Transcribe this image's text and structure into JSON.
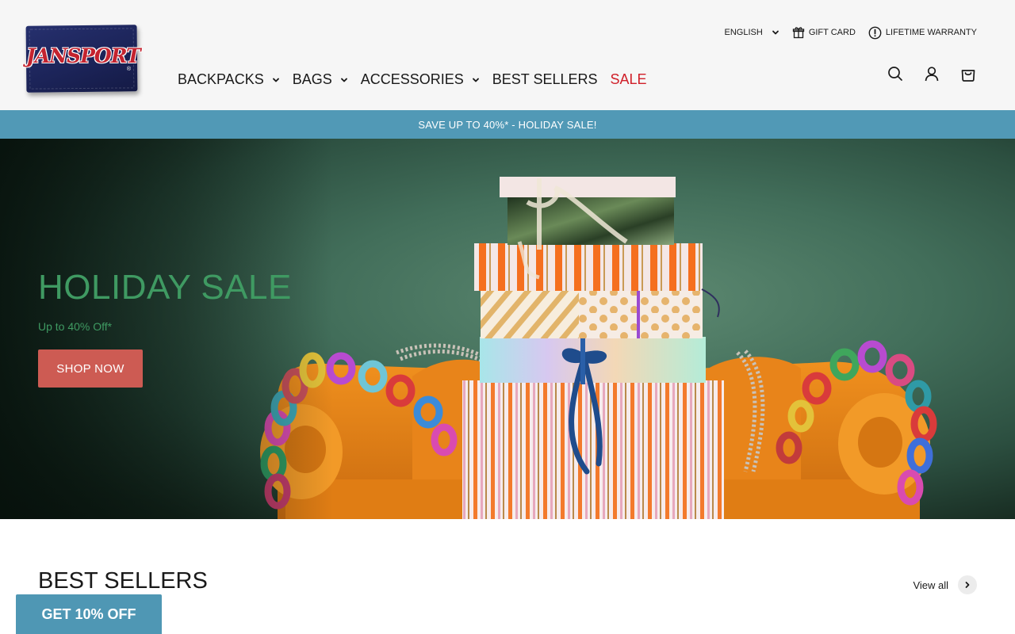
{
  "brand": {
    "logo_text": "JANSPORT",
    "logo_mark": "®",
    "patch_color": "#1c2459",
    "text_color": "#c4232f"
  },
  "topbar": {
    "language": "ENGLISH",
    "gift_card": "GIFT CARD",
    "warranty": "LIFETIME WARRANTY"
  },
  "nav": {
    "items": [
      {
        "label": "BACKPACKS",
        "has_dropdown": true
      },
      {
        "label": "BAGS",
        "has_dropdown": true
      },
      {
        "label": "ACCESSORIES",
        "has_dropdown": true
      },
      {
        "label": "BEST SELLERS",
        "has_dropdown": false
      },
      {
        "label": "SALE",
        "has_dropdown": false,
        "color": "#d0202a"
      }
    ]
  },
  "header_icons": [
    "search-icon",
    "account-icon",
    "cart-icon"
  ],
  "announcement": {
    "text": "SAVE UP TO 40%* - HOLIDAY SALE!",
    "background": "#5199b6"
  },
  "hero": {
    "title": "HOLIDAY SALE",
    "subtitle": "Up to 40% Off*",
    "button_label": "SHOP NOW",
    "title_color": "#3f9a62",
    "button_color": "#cd5b53"
  },
  "best_sellers": {
    "title": "BEST SELLERS",
    "view_all": "View all"
  },
  "promo": {
    "label": "GET 10% OFF",
    "background": "#4f97b4"
  }
}
